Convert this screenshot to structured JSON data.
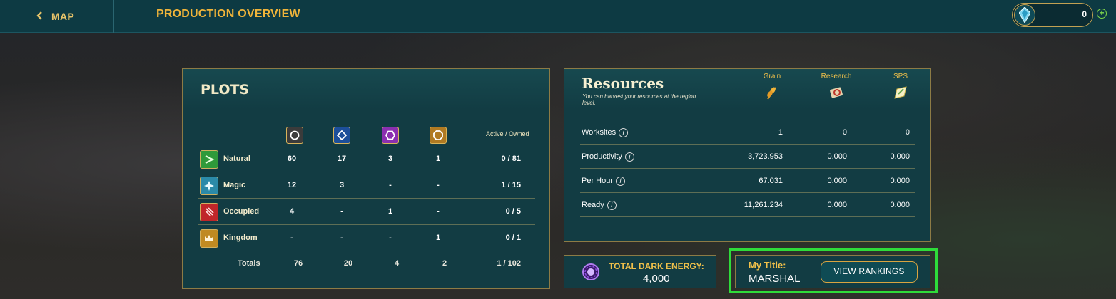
{
  "topbar": {
    "back_label": "MAP",
    "title": "PRODUCTION OVERVIEW",
    "currency_value": "0",
    "plus_symbol": "+"
  },
  "plots": {
    "title": "PLOTS",
    "active_owned_label": "Active / Owned",
    "type_icons": [
      "circle-plot-icon",
      "diamond-plot-icon",
      "hexagon-plot-icon",
      "octagon-plot-icon"
    ],
    "rows": [
      {
        "label": "Natural",
        "icon": "natural-icon",
        "c1": "60",
        "c2": "17",
        "c3": "3",
        "c4": "1",
        "ratio": "0 / 81"
      },
      {
        "label": "Magic",
        "icon": "magic-icon",
        "c1": "12",
        "c2": "3",
        "c3": "-",
        "c4": "-",
        "ratio": "1 / 15"
      },
      {
        "label": "Occupied",
        "icon": "occupied-icon",
        "c1": "4",
        "c2": "-",
        "c3": "1",
        "c4": "-",
        "ratio": "0 / 5"
      },
      {
        "label": "Kingdom",
        "icon": "kingdom-icon",
        "c1": "-",
        "c2": "-",
        "c3": "-",
        "c4": "1",
        "ratio": "0 / 1"
      }
    ],
    "totals": {
      "label": "Totals",
      "c1": "76",
      "c2": "20",
      "c3": "4",
      "c4": "2",
      "ratio": "1 / 102"
    }
  },
  "resources": {
    "title": "Resources",
    "subtitle": "You can harvest your resources at the region level.",
    "columns": [
      {
        "label": "Grain",
        "icon": "grain-icon"
      },
      {
        "label": "Research",
        "icon": "research-icon"
      },
      {
        "label": "SPS",
        "icon": "sps-icon"
      }
    ],
    "info_glyph": "i",
    "rows": [
      {
        "label": "Worksites",
        "grain": "1",
        "research": "0",
        "sps": "0"
      },
      {
        "label": "Productivity",
        "grain": "3,723.953",
        "research": "0.000",
        "sps": "0.000"
      },
      {
        "label": "Per Hour",
        "grain": "67.031",
        "research": "0.000",
        "sps": "0.000"
      },
      {
        "label": "Ready",
        "grain": "11,261.234",
        "research": "0.000",
        "sps": "0.000"
      }
    ]
  },
  "dark_energy": {
    "label": "TOTAL DARK ENERGY:",
    "value": "4,000"
  },
  "title_panel": {
    "label": "My Title:",
    "value": "MARSHAL",
    "button_label": "VIEW RANKINGS"
  },
  "colors": {
    "accent_gold": "#f0b43a",
    "panel_bg": "#123c43",
    "highlight_green": "#2edc3a"
  }
}
